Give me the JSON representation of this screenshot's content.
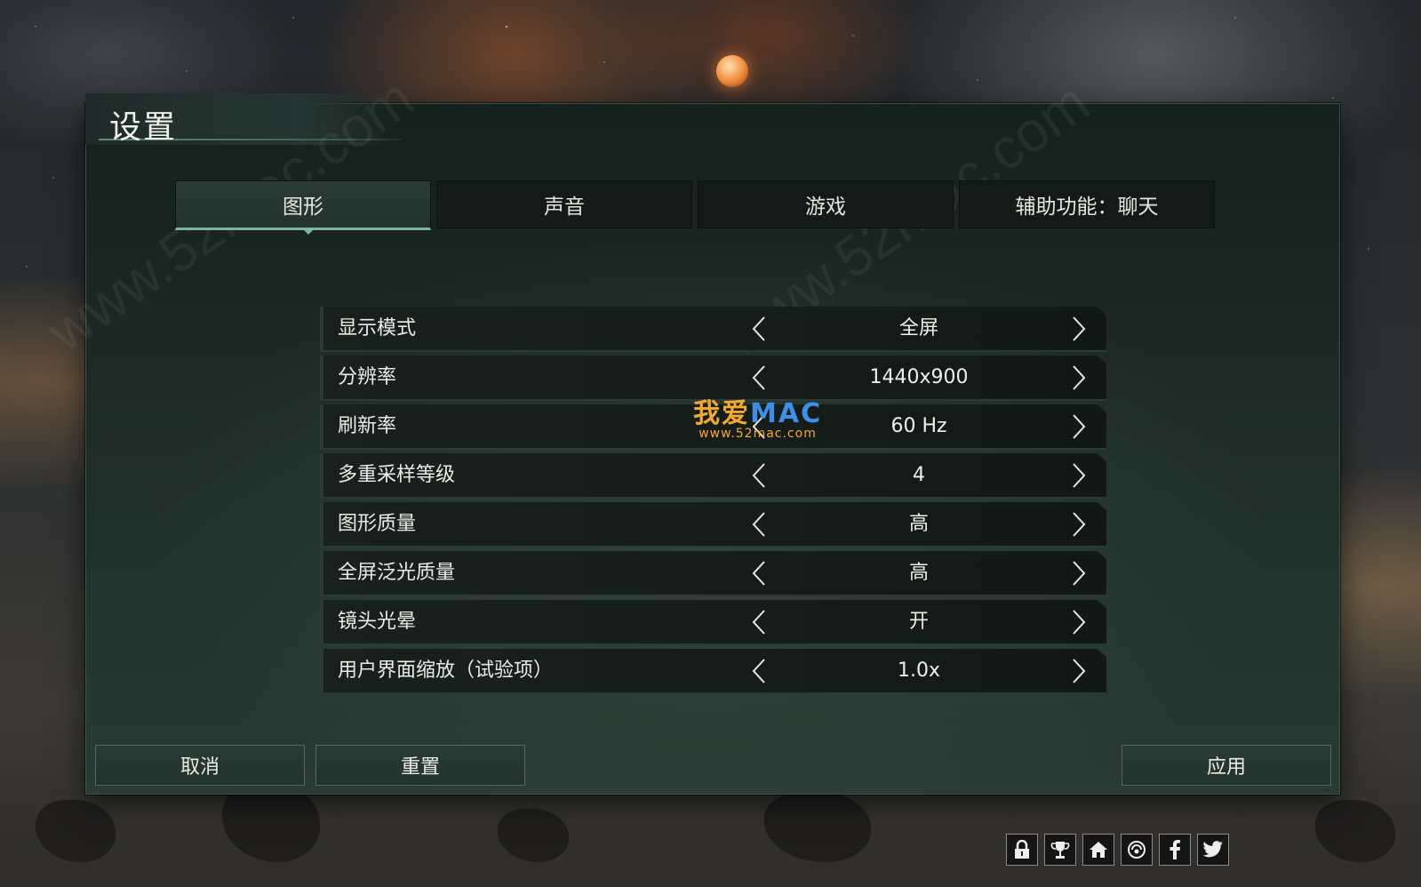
{
  "window": {
    "title": "设置"
  },
  "tabs": [
    {
      "label": "图形",
      "active": true
    },
    {
      "label": "声音",
      "active": false
    },
    {
      "label": "游戏",
      "active": false
    },
    {
      "label": "辅助功能：聊天",
      "active": false
    }
  ],
  "settings": [
    {
      "label": "显示模式",
      "value": "全屏"
    },
    {
      "label": "分辨率",
      "value": "1440x900"
    },
    {
      "label": "刷新率",
      "value": "60 Hz"
    },
    {
      "label": "多重采样等级",
      "value": "4"
    },
    {
      "label": "图形质量",
      "value": "高"
    },
    {
      "label": "全屏泛光质量",
      "value": "高"
    },
    {
      "label": "镜头光晕",
      "value": "开"
    },
    {
      "label": "用户界面缩放（试验项）",
      "value": "1.0x"
    }
  ],
  "buttons": {
    "cancel": "取消",
    "reset": "重置",
    "apply": "应用"
  },
  "watermark": {
    "cn": "我爱",
    "en": "MAC",
    "url": "www.52mac.com",
    "diagonal": "www.52mac.com"
  },
  "social_icons": [
    "lock-icon",
    "trophy-icon",
    "home-icon",
    "paradox-icon",
    "facebook-icon",
    "twitter-icon"
  ],
  "colors": {
    "accent": "#7fb3a2",
    "panel": "#1d2a26",
    "text": "#ecece6"
  }
}
